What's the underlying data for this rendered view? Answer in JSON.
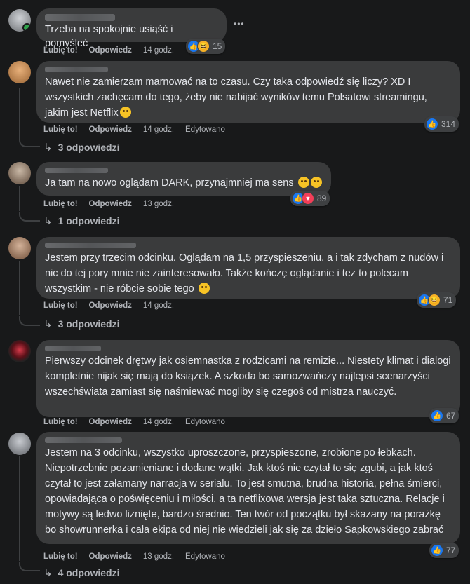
{
  "comments": [
    {
      "text": "Trzeba na spokojnie usiąść i pomyśleć",
      "like": "Lubię to!",
      "reply": "Odpowiedz",
      "time": "14 godz.",
      "edited": "",
      "reactions": "15",
      "replies": ""
    },
    {
      "text": "Nawet nie zamierzam marnować na to czasu. Czy taka odpowiedź się liczy? XD I wszystkich zachęcam do tego, żeby nie nabijać wyników temu Polsatowi streamingu, jakim jest Netflix",
      "like": "Lubię to!",
      "reply": "Odpowiedz",
      "time": "14 godz.",
      "edited": "Edytowano",
      "reactions": "314",
      "replies": "3 odpowiedzi"
    },
    {
      "text": "Ja tam na nowo oglądam DARK, przynajmniej ma sens",
      "like": "Lubię to!",
      "reply": "Odpowiedz",
      "time": "13 godz.",
      "edited": "",
      "reactions": "89",
      "replies": "1 odpowiedzi"
    },
    {
      "text": "Jestem przy trzecim odcinku. Oglądam na 1,5 przyspieszeniu, a i tak zdycham z nudów i nic do tej pory mnie nie zainteresowało. Także kończę oglądanie i tez to polecam wszystkim - nie róbcie sobie tego",
      "like": "Lubię to!",
      "reply": "Odpowiedz",
      "time": "14 godz.",
      "edited": "",
      "reactions": "71",
      "replies": "3 odpowiedzi"
    },
    {
      "text": "Pierwszy odcinek drętwy jak osiemnastka z rodzicami na remizie... Niestety klimat i dialogi kompletnie nijak się mają do książek. A szkoda bo samozwańczy najlepsi scenarzyści wszechświata zamiast się naśmiewać mogliby się czegoś od mistrza nauczyć.",
      "like": "Lubię to!",
      "reply": "Odpowiedz",
      "time": "14 godz.",
      "edited": "Edytowano",
      "reactions": "67",
      "replies": ""
    },
    {
      "text": "Jestem na 3 odcinku, wszystko uproszczone, przyspieszone, zrobione po łebkach. Niepotrzebnie pozamieniane i dodane wątki. Jak ktoś nie czytał to się zgubi, a jak ktoś czytał to jest załamany narracja w serialu. To jest smutna, brudna historia, pełna śmierci, opowiadająca o poświęceniu i miłości, a ta netflixowa wersja jest taka sztuczna. Relacje i motywy są ledwo liznięte, bardzo średnio. Ten twór od początku był skazany na porażkę bo showrunnerka i cała ekipa od niej nie wiedzieli jak się za dzieło Sapkowskiego zabrać",
      "like": "Lubię to!",
      "reply": "Odpowiedz",
      "time": "13 godz.",
      "edited": "Edytowano",
      "reactions": "77",
      "replies": "4 odpowiedzi"
    }
  ],
  "colors": {
    "bg": "#18191a",
    "bubble": "#3a3b3c",
    "like": "#1877f2",
    "love": "#f33e58",
    "haha": "#f7b125",
    "online": "#31a24c"
  },
  "icons": {
    "reply_arrow": "↳",
    "more": "•••"
  }
}
